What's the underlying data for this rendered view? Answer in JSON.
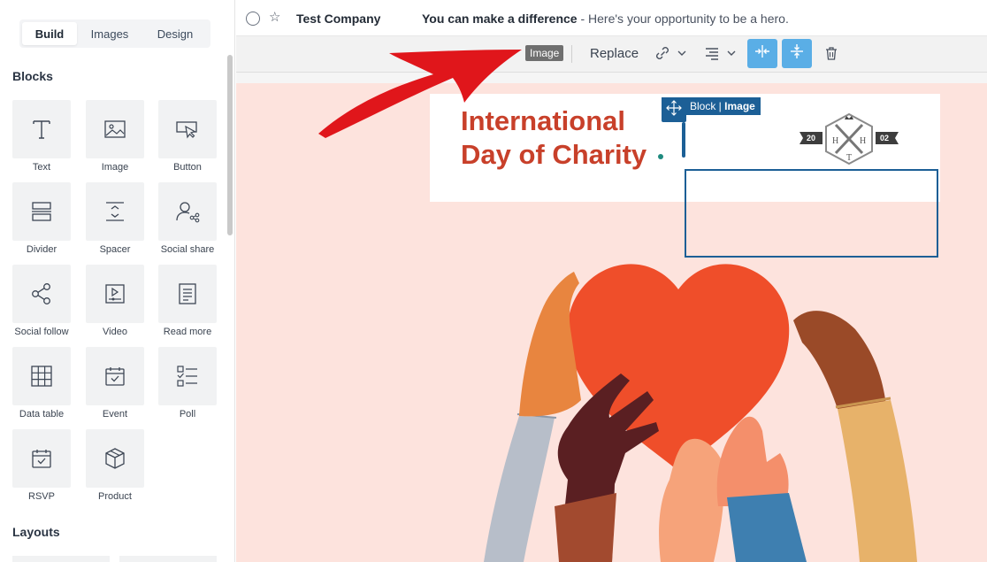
{
  "sidebar": {
    "tabs": [
      {
        "label": "Build",
        "active": true
      },
      {
        "label": "Images",
        "active": false
      },
      {
        "label": "Design",
        "active": false
      }
    ],
    "blocks_title": "Blocks",
    "blocks": [
      {
        "label": "Text",
        "icon": "text-icon"
      },
      {
        "label": "Image",
        "icon": "image-icon"
      },
      {
        "label": "Button",
        "icon": "button-cursor-icon"
      },
      {
        "label": "Divider",
        "icon": "divider-icon"
      },
      {
        "label": "Spacer",
        "icon": "spacer-icon"
      },
      {
        "label": "Social share",
        "icon": "social-share-icon"
      },
      {
        "label": "Social follow",
        "icon": "share-nodes-icon"
      },
      {
        "label": "Video",
        "icon": "video-icon"
      },
      {
        "label": "Read more",
        "icon": "document-icon"
      },
      {
        "label": "Data table",
        "icon": "table-grid-icon"
      },
      {
        "label": "Event",
        "icon": "calendar-check-icon"
      },
      {
        "label": "Poll",
        "icon": "checklist-icon"
      },
      {
        "label": "RSVP",
        "icon": "rsvp-calendar-icon"
      },
      {
        "label": "Product",
        "icon": "box-icon"
      }
    ],
    "layouts_title": "Layouts"
  },
  "header": {
    "sender": "Test Company",
    "subject_bold": "You can make a difference",
    "subject_rest": " - Here's your opportunity to be a hero."
  },
  "toolbar": {
    "chip_label": "Image",
    "replace_label": "Replace"
  },
  "canvas": {
    "title_line1": "International",
    "title_line2": "Day of Charity",
    "block_label_prefix": "Block | ",
    "block_label_name": "Image",
    "logo_left_year": "20",
    "logo_right_year": "02",
    "logo_letters": [
      "H",
      "H",
      "T"
    ]
  },
  "colors": {
    "accent_blue": "#1c5f96",
    "toolbar_button": "#5aaee6",
    "title_red": "#c8402a",
    "canvas_bg": "#fde3dd",
    "annotation_red": "#e0161b"
  }
}
